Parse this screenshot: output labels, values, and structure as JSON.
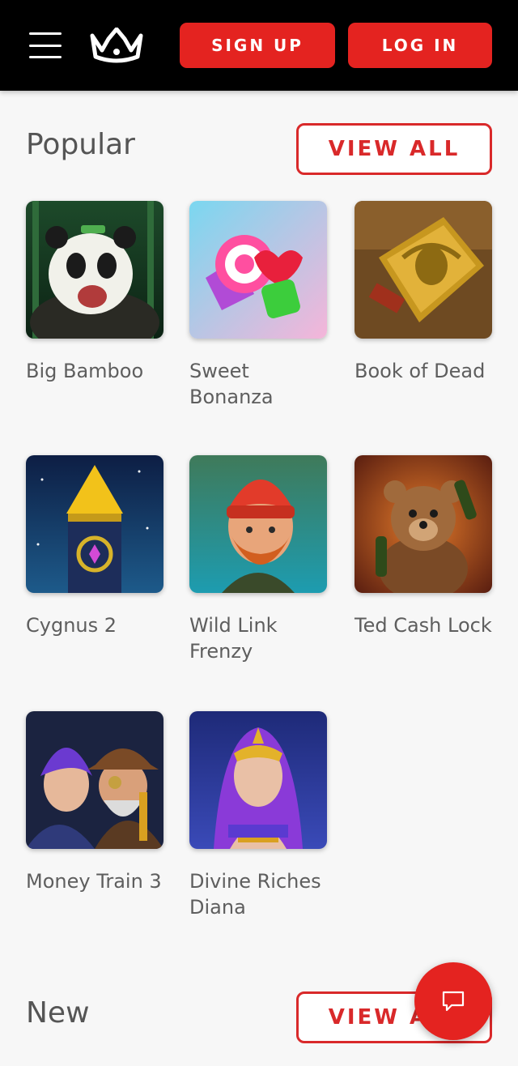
{
  "header": {
    "menu_icon": "hamburger-menu-icon",
    "logo_icon": "crown-logo-icon",
    "signup_label": "SIGN UP",
    "login_label": "LOG IN"
  },
  "colors": {
    "header_bg": "#000000",
    "accent_red": "#e42320",
    "page_bg": "#f7f7f7"
  },
  "popular": {
    "title": "Popular",
    "view_all_label": "VIEW ALL",
    "games": [
      {
        "name": "Big Bamboo"
      },
      {
        "name": "Sweet Bonanza"
      },
      {
        "name": "Book of Dead"
      },
      {
        "name": "Cygnus 2"
      },
      {
        "name": "Wild Link Frenzy"
      },
      {
        "name": "Ted Cash Lock"
      },
      {
        "name": "Money Train 3"
      },
      {
        "name": "Divine Riches Diana"
      }
    ]
  },
  "new_section": {
    "title": "New",
    "view_all_label": "VIEW ALL"
  },
  "chat": {
    "icon": "chat-bubble-icon"
  }
}
